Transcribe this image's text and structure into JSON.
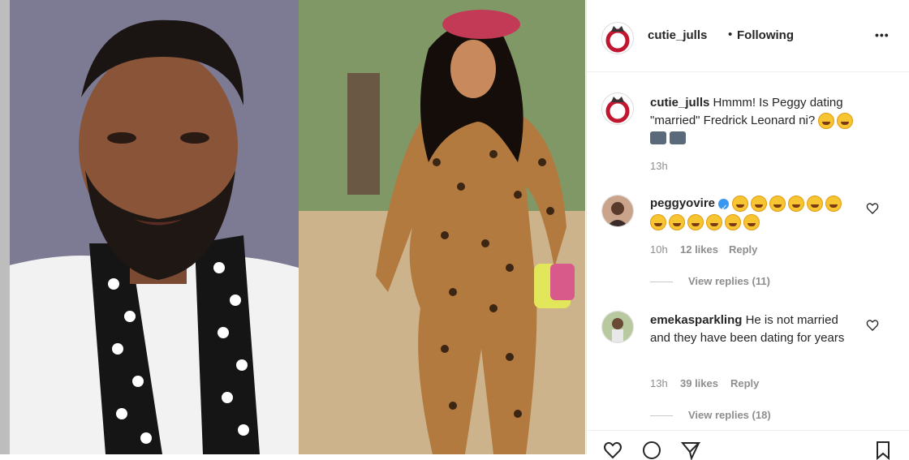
{
  "post": {
    "username": "cutie_julls",
    "follow_status": "Following",
    "bullet": "•",
    "more_label": "•••"
  },
  "caption": {
    "username": "cutie_julls",
    "text": "Hmmm! Is Peggy dating \"married\" Fredrick Leonard ni?",
    "time": "13h"
  },
  "comments": [
    {
      "username": "peggyovire",
      "verified": true,
      "text": "",
      "time": "10h",
      "likes": "12 likes",
      "reply": "Reply",
      "view_replies": "View replies (11)"
    },
    {
      "username": "emekasparkling",
      "verified": false,
      "text": "He is not married and they have been dating for years",
      "time": "13h",
      "likes": "39 likes",
      "reply": "Reply",
      "view_replies": "View replies (18)"
    }
  ],
  "colors": {
    "link": "#262626",
    "muted": "#8e8e8e",
    "verified": "#3897f0"
  }
}
